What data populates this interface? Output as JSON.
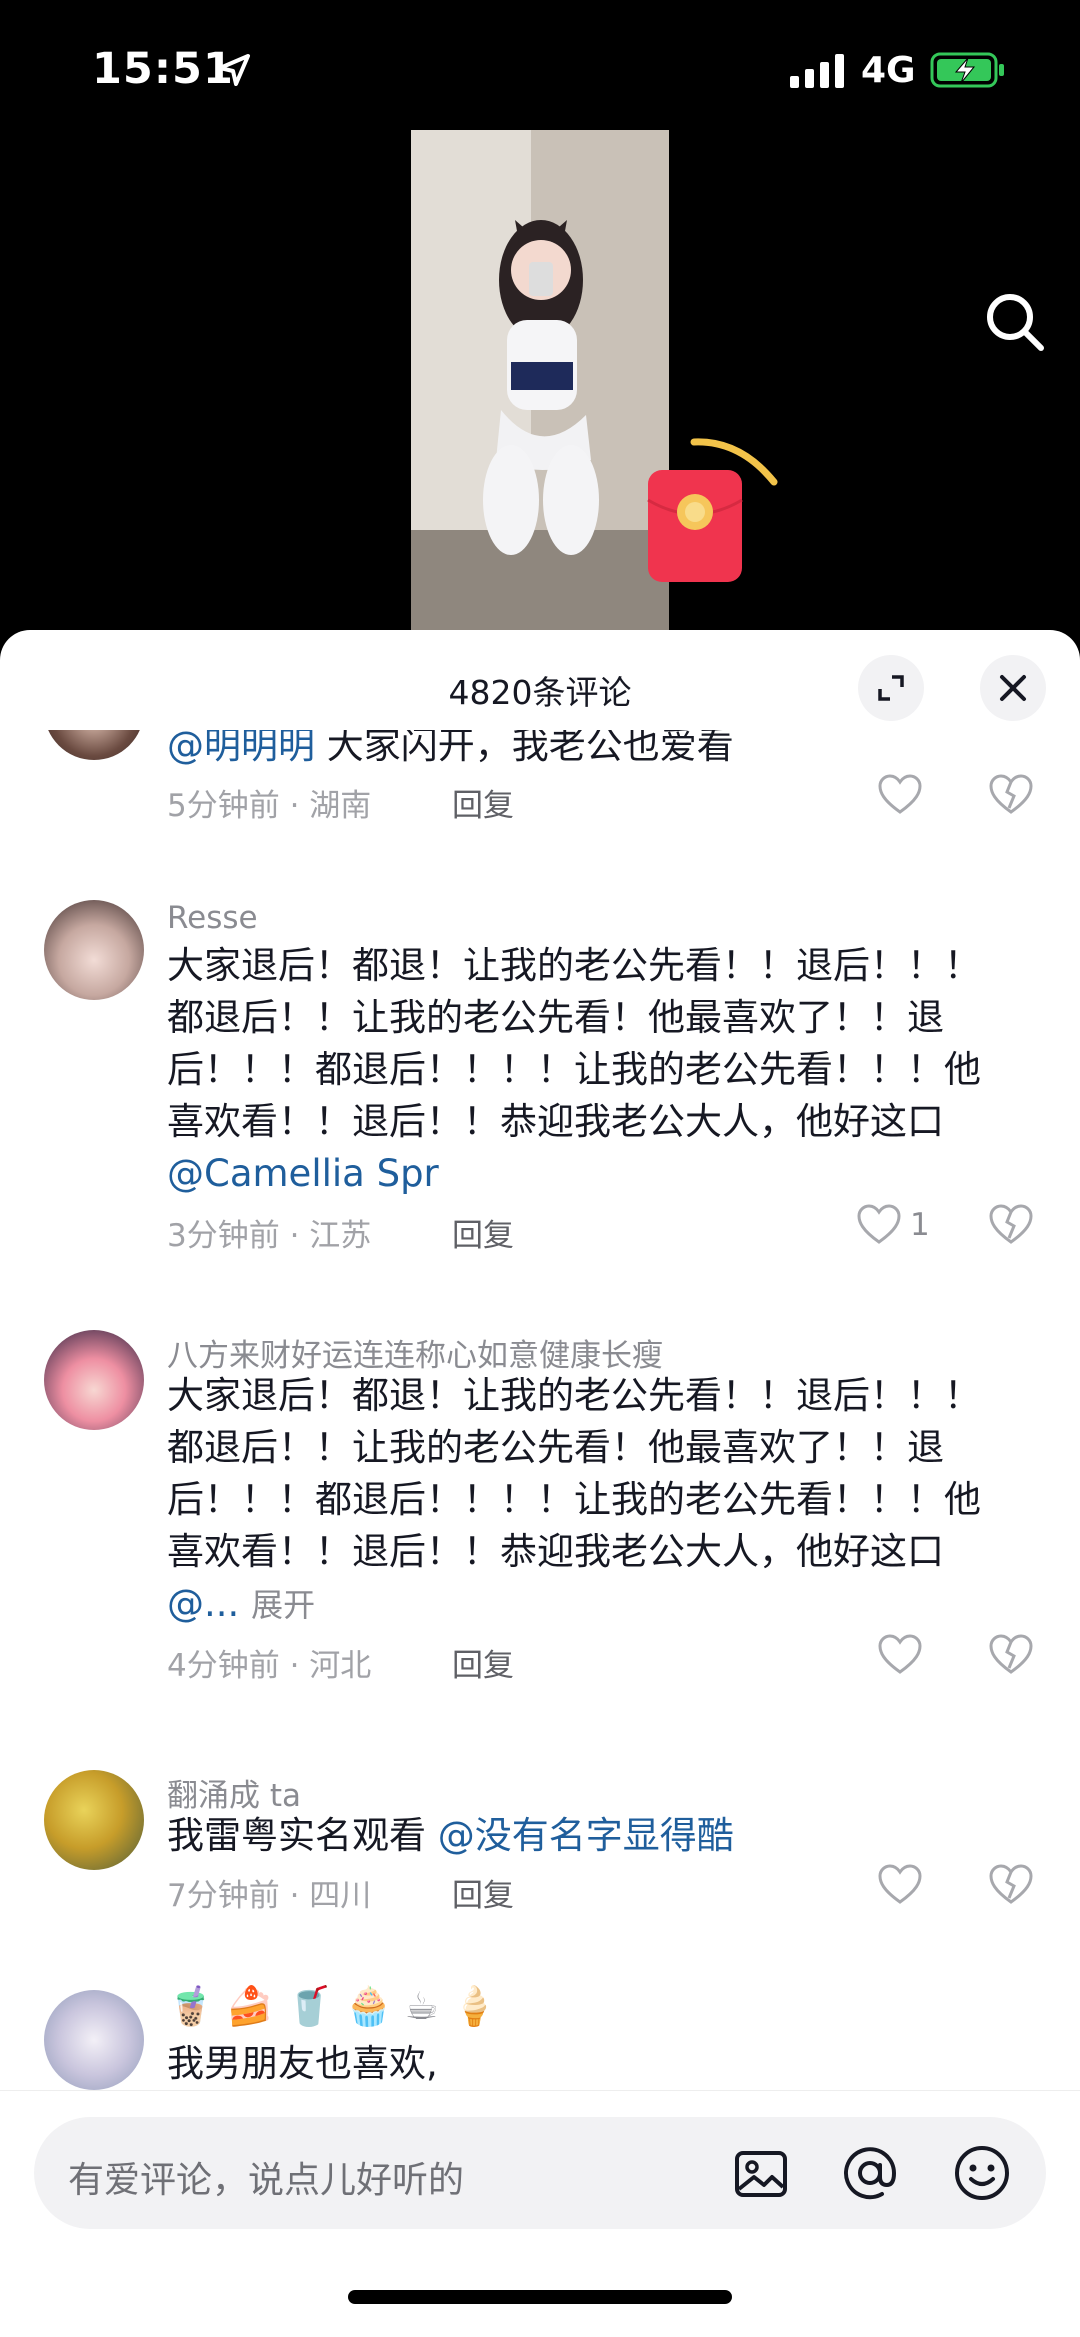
{
  "status_bar": {
    "time": "15:51",
    "network": "4G"
  },
  "comments_panel": {
    "title": "4820条评论",
    "comments": [
      {
        "author": "",
        "mention": "@明明明",
        "text": " 大家闪开，我老公也爱看",
        "time": "5分钟前 · 湖南",
        "reply": "回复",
        "likes": ""
      },
      {
        "author": "Resse",
        "text": "大家退后！都退！让我的老公先看！！退后！！！都退后！！让我的老公先看！他最喜欢了！！退后！！！都退后！！！！让我的老公先看！！！他喜欢看！！退后！！恭迎我老公大人，他好这口",
        "mention": "@Camellia Spr",
        "time": "3分钟前 · 江苏",
        "reply": "回复",
        "likes": "1"
      },
      {
        "author": "八方来财好运连连称心如意健康长瘦",
        "text": "大家退后！都退！让我的老公先看！！退后！！！都退后！！让我的老公先看！他最喜欢了！！退后！！！都退后！！！！让我的老公先看！！！他喜欢看！！退后！！恭迎我老公大人，他好这口",
        "mention": "@...",
        "expand": "展开",
        "time": "4分钟前 · 河北",
        "reply": "回复",
        "likes": ""
      },
      {
        "author": "翻涌成 ta",
        "text": "我雷粤实名观看 ",
        "mention": "@没有名字显得酷",
        "time": "7分钟前 · 四川",
        "reply": "回复",
        "likes": ""
      },
      {
        "author": "",
        "emojis": "🧋 🍰 🥤 🧁 ☕ 🍦",
        "text": "我男朋友也喜欢,"
      }
    ]
  },
  "input": {
    "placeholder": "有爱评论，说点儿好听的"
  },
  "icons": [
    "location-arrow-icon",
    "signal-icon",
    "battery-charging-icon",
    "search-icon",
    "red-packet-icon",
    "expand-icon",
    "close-icon",
    "heart-icon",
    "broken-heart-icon",
    "image-icon",
    "at-icon",
    "smile-icon"
  ],
  "colors": {
    "mention": "#1f5e9c",
    "battery": "#34c759",
    "red_packet": "#f0344e"
  }
}
